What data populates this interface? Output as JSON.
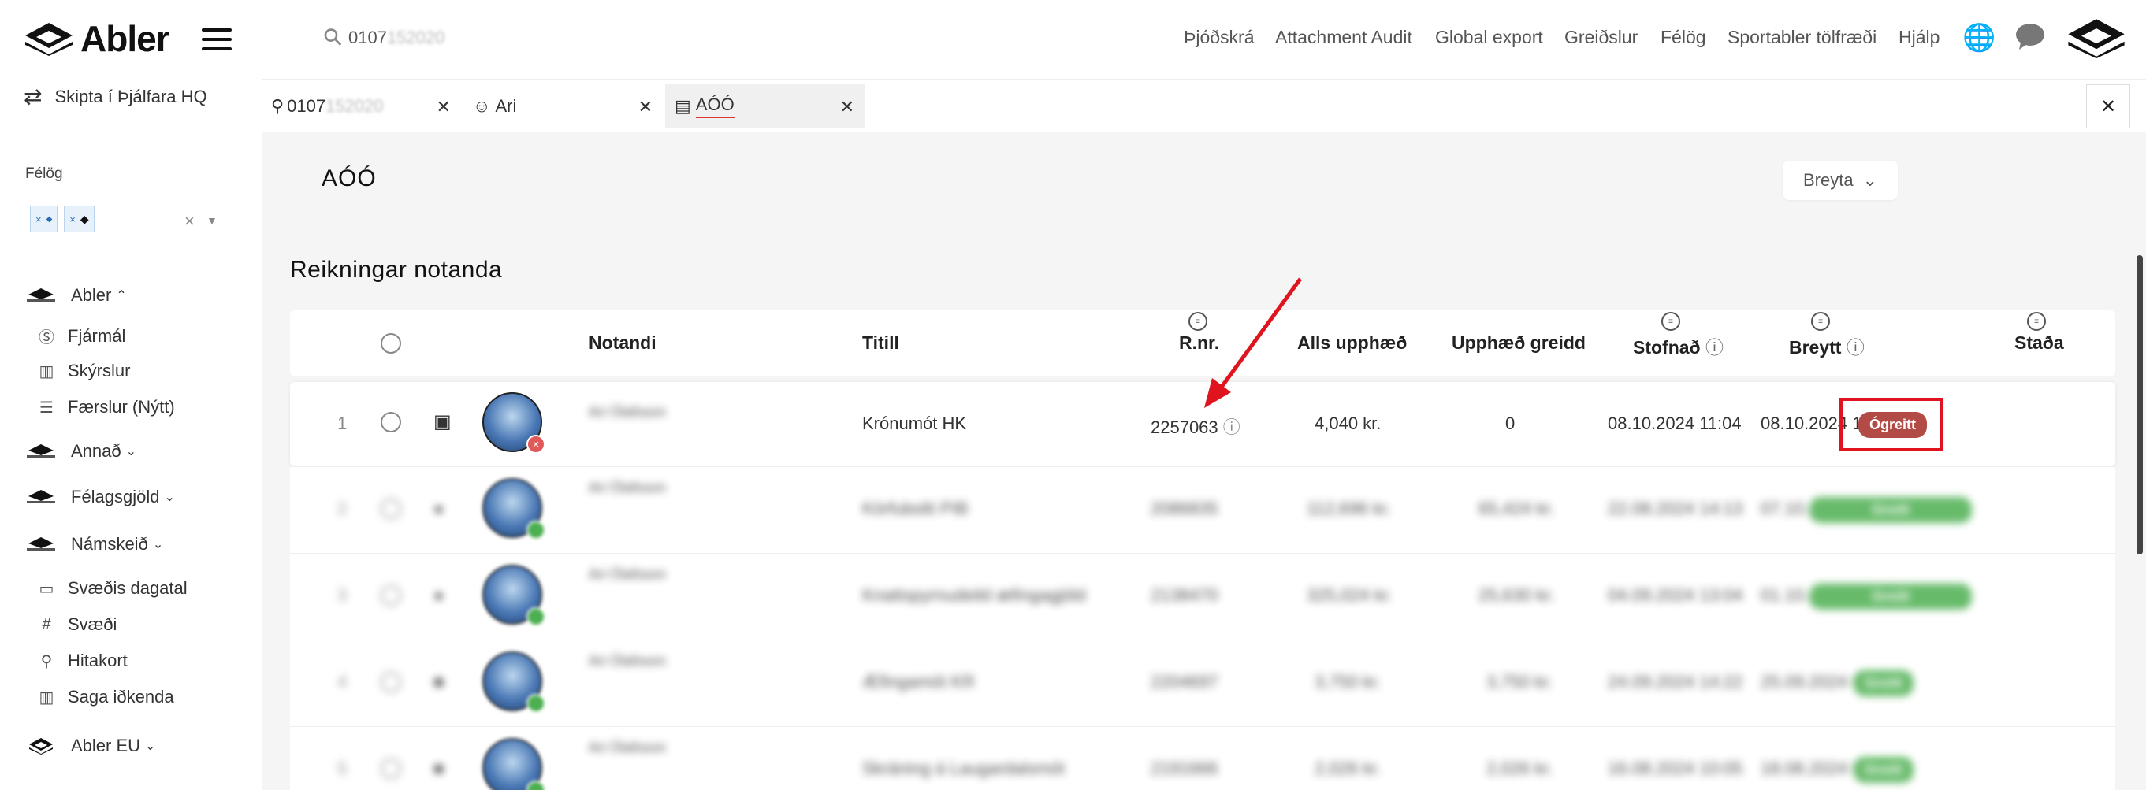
{
  "brand": {
    "name": "Abler"
  },
  "sidebar": {
    "switch_label": "Skipta í Þjálfara HQ",
    "clubs_label": "Félög",
    "groups": [
      {
        "label": "Abler",
        "expanded": true,
        "items": [
          "Fjármál",
          "Skýrslur",
          "Færslur (Nýtt)"
        ]
      },
      {
        "label": "Annað"
      },
      {
        "label": "Félagsgjöld"
      },
      {
        "label": "Námskeið",
        "expanded": true,
        "items": [
          "Svæðis dagatal",
          "Svæði",
          "Hitakort",
          "Saga iðkenda"
        ]
      },
      {
        "label": "Abler EU"
      }
    ]
  },
  "topbar": {
    "search_value": "0107",
    "nav": [
      "Þjóðskrá",
      "Attachment Audit",
      "Global export",
      "Greiðslur",
      "Félög",
      "Sportabler tölfræði",
      "Hjálp"
    ]
  },
  "tabs": [
    {
      "label": "0107"
    },
    {
      "label": "Ari"
    },
    {
      "label": "AÓÓ",
      "active": true
    }
  ],
  "page": {
    "title": "AÓÓ",
    "edit_label": "Breyta",
    "section_title": "Reikningar notanda"
  },
  "table": {
    "columns": [
      "Notandi",
      "Titill",
      "R.nr.",
      "Alls upphæð",
      "Upphæð greidd",
      "Stofnað",
      "Breytt",
      "Staða"
    ],
    "rows": [
      {
        "index": "1",
        "user": "Ari Ólafsson",
        "title": "Krónumót HK",
        "rnr": "2257063",
        "total": "4,040 kr.",
        "paid": "0",
        "created": "08.10.2024 11:04",
        "updated": "08.10.2024 11:04",
        "status": "Ógreitt"
      },
      {
        "index": "2",
        "user": "Ari Ólafsson",
        "title": "Körfubolti PIB",
        "rnr": "2086835",
        "total": "112,696 kr.",
        "paid": "65,424 kr.",
        "created": "22.08.2024 14:13",
        "updated": "07.10.2024 16:44",
        "status": "Greitt"
      },
      {
        "index": "3",
        "user": "Ari Ólafsson",
        "title": "Knattspyrnudeild æfingagjöld",
        "rnr": "2138470",
        "total": "325,024 kr.",
        "paid": "25,630 kr.",
        "created": "04.09.2024 13:04",
        "updated": "01.10.2024 11:04",
        "status": "Greitt"
      },
      {
        "index": "4",
        "user": "Ari Ólafsson",
        "title": "Æfingamót KR",
        "rnr": "2204697",
        "total": "3,750 kr.",
        "paid": "3,750 kr.",
        "created": "24.09.2024 14:22",
        "updated": "25.09.2024 07:07",
        "status": "Greitt"
      },
      {
        "index": "5",
        "user": "Ari Ólafsson",
        "title": "Skráning á Laugardalsmót",
        "rnr": "2191666",
        "total": "2,026 kr.",
        "paid": "2,026 kr.",
        "created": "16.08.2024 10:05",
        "updated": "18.08.2024 07:28",
        "status": "Greitt"
      }
    ]
  }
}
